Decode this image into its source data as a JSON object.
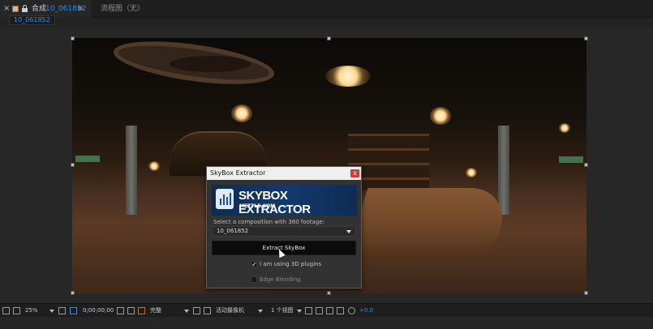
{
  "tabbar": {
    "close": "×",
    "comp_label": "合成",
    "comp_name": "10_061852",
    "menu": "≡",
    "flowchart": "流程图（无）"
  },
  "breadcrumb": {
    "label": "10_061852"
  },
  "dialog": {
    "title": "SkyBox Extractor",
    "close": "x",
    "banner_title": "SKYBOX EXTRACTOR",
    "banner_sub": "METTLE.COM",
    "prompt": "Select a composition with 360 footage:",
    "selected_comp": "10_061852",
    "button": "Extract SkyBox",
    "check_3d": {
      "label": "I am using 3D plugins",
      "checked": true,
      "mark": "✓"
    },
    "check_edge": {
      "label": "Edge Blending",
      "checked": false
    }
  },
  "bottombar": {
    "zoom": "25%",
    "timecode": "0;00;00;00",
    "resolution": "完整",
    "camera": "活动摄像机",
    "views": "1 个视图",
    "exposure": "+0.0"
  }
}
